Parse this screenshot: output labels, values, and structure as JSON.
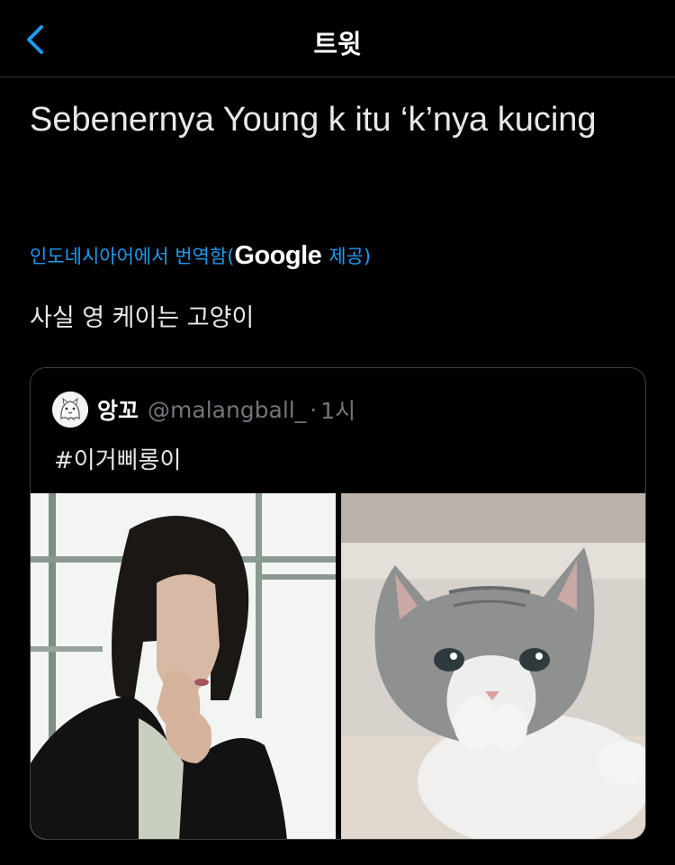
{
  "header": {
    "title": "트윗",
    "back_icon": "chevron-left-icon"
  },
  "tweet": {
    "text": "Sebenernya Young k itu ‘k’nya kucing",
    "translate": {
      "prefix": "인도네시아어에서 번역함(",
      "brand": "Google",
      "suffix": " 제공)"
    },
    "translated_text": "사실 영 케이는 고양이"
  },
  "quoted_tweet": {
    "name": "앙꼬",
    "handle": "@malangball_",
    "separator": "·",
    "time": "1시",
    "text": "#이거삐롱이"
  },
  "colors": {
    "background": "#000000",
    "accent": "#1d9bf0",
    "text": "#e7e9ea",
    "muted": "#71767b",
    "border": "#2f3336"
  }
}
